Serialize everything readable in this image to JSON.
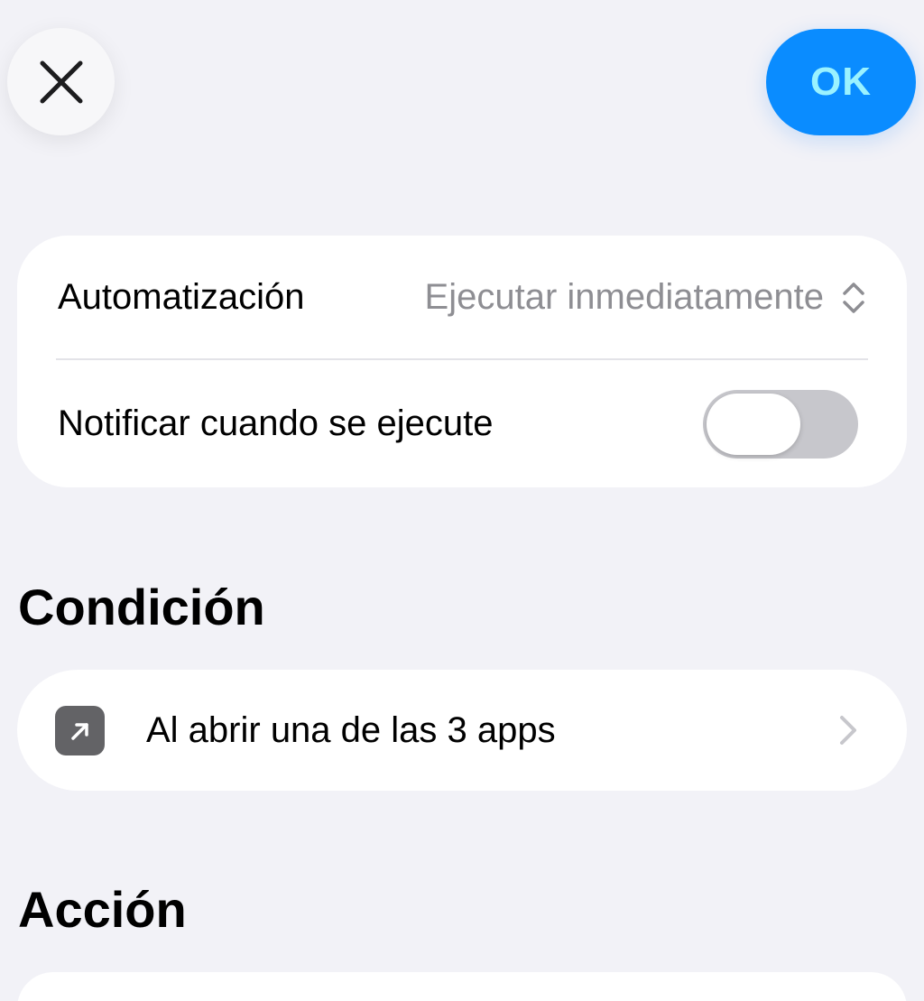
{
  "header": {
    "close_icon": "close-icon",
    "ok_label": "OK",
    "ok_color": "#0a8cff"
  },
  "settings": {
    "automation_label": "Automatización",
    "automation_value": "Ejecutar inmediatamente",
    "notify_label": "Notificar cuando se ejecute",
    "notify_enabled": false
  },
  "condition": {
    "section_title": "Condición",
    "item_icon": "arrow-up-right-icon",
    "item_label": "Al abrir una de las 3 apps"
  },
  "action": {
    "section_title": "Acción"
  }
}
